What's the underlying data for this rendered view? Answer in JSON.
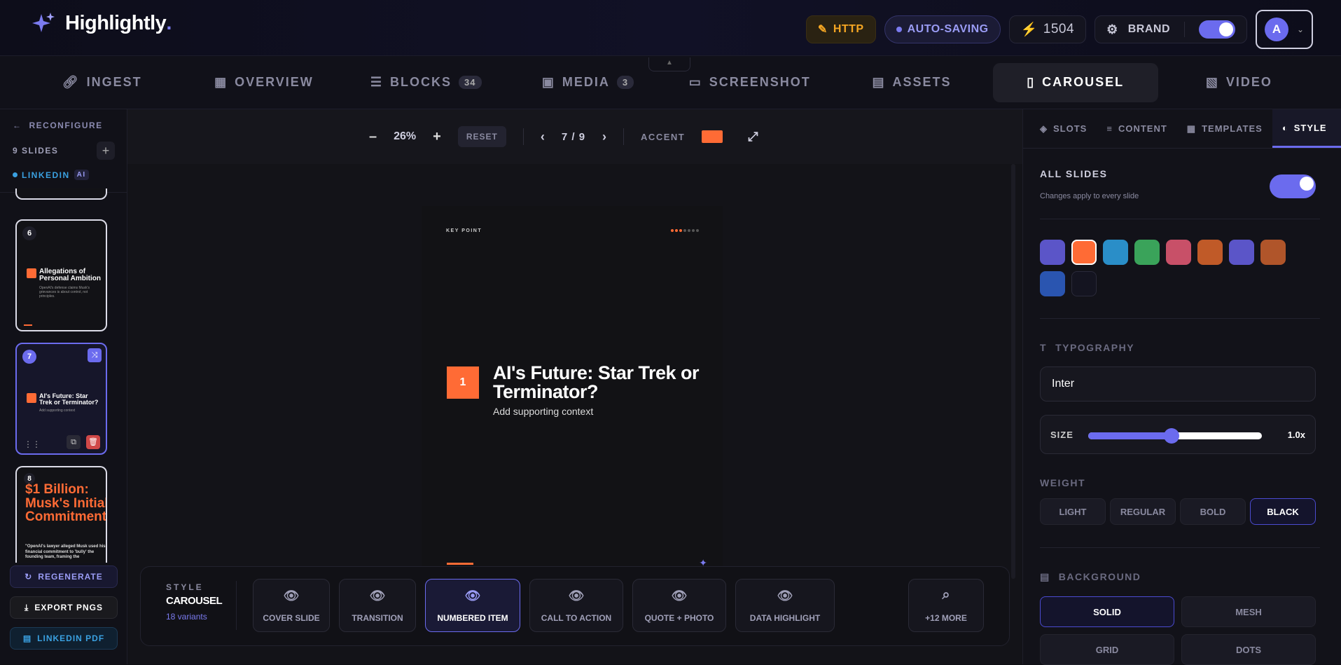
{
  "app": {
    "name": "Highlightly",
    "dot": "."
  },
  "topbar": {
    "http": "HTTP",
    "autosave": "AUTO-SAVING",
    "credits": "1504",
    "brand": "BRAND",
    "avatar": "A"
  },
  "tabs": [
    {
      "label": "INGEST"
    },
    {
      "label": "OVERVIEW"
    },
    {
      "label": "BLOCKS",
      "badge": "34"
    },
    {
      "label": "MEDIA",
      "badge": "3"
    },
    {
      "label": "SCREENSHOT"
    },
    {
      "label": "ASSETS"
    },
    {
      "label": "CAROUSEL"
    },
    {
      "label": "VIDEO"
    }
  ],
  "left": {
    "reconfigure": "RECONFIGURE",
    "slides_count": "9 SLIDES",
    "platform": "LINKEDIN",
    "ai": "AI",
    "thumbs": [
      {
        "num": "6",
        "title": "Allegations of Personal Ambition",
        "sub": "OpenAI's defense claims Musk's grievances is about control, not principles."
      },
      {
        "num": "7",
        "title": "AI's Future: Star Trek or Terminator?",
        "sub": "Add supporting context"
      },
      {
        "num": "8",
        "title": "$1 Billion: Musk's Initial Commitment",
        "sub": "\"OpenAI's lawyer alleged Musk used his financial commitment to 'bully' the founding team, framing the"
      }
    ],
    "regenerate": "REGENERATE",
    "export": "EXPORT PNGS",
    "pdf": "LINKEDIN PDF"
  },
  "toolbar": {
    "zoom": "26%",
    "reset": "RESET",
    "page": "7 / 9",
    "accent": "ACCENT",
    "accent_color": "#ff6b35"
  },
  "slide": {
    "kicker": "KEY POINT",
    "number": "1",
    "title": "AI's Future: Star Trek or Terminator?",
    "context": "Add supporting context"
  },
  "stylebar": {
    "label": "STYLE",
    "name": "CAROUSEL",
    "variants": "18 variants",
    "cards": [
      "COVER SLIDE",
      "TRANSITION",
      "NUMBERED ITEM",
      "CALL TO ACTION",
      "QUOTE + PHOTO",
      "DATA HIGHLIGHT"
    ],
    "more": "+12 MORE"
  },
  "right": {
    "tabs": [
      "SLOTS",
      "CONTENT",
      "TEMPLATES",
      "STYLE"
    ],
    "all_slides": "ALL SLIDES",
    "all_sub": "Changes apply to every slide",
    "swatches": [
      "#5b55c8",
      "#ff6b35",
      "#2a8ec8",
      "#3aa35a",
      "#c85068",
      "#c05a28",
      "#5b55c8",
      "#b0552a",
      "#2a55b0",
      "#141420"
    ],
    "typography": "TYPOGRAPHY",
    "font": "Inter",
    "size_label": "SIZE",
    "size_val": "1.0x",
    "size_level": 0.48,
    "weight": "WEIGHT",
    "weights": [
      "LIGHT",
      "REGULAR",
      "BOLD",
      "BLACK"
    ],
    "background": "BACKGROUND",
    "bgs": [
      "SOLID",
      "MESH",
      "GRID",
      "DOTS"
    ]
  }
}
